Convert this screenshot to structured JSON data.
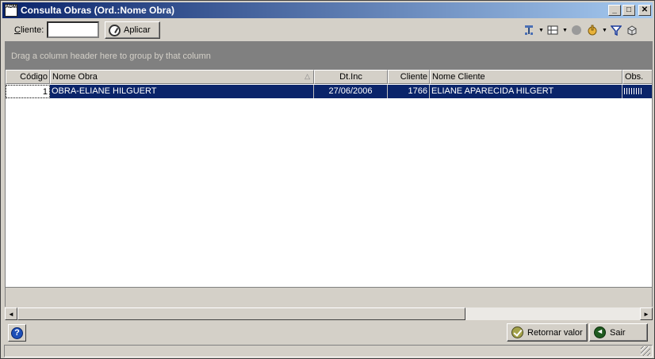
{
  "window": {
    "title": "Consulta Obras (Ord.:Nome Obra)",
    "icon_text": "ADM",
    "minimize": "_",
    "maximize": "□",
    "close": "✕"
  },
  "toolbar": {
    "cliente_label": "Cliente:",
    "cliente_value": "",
    "aplicar_label": "Aplicar",
    "icons": [
      "layout-icon",
      "columns-icon",
      "circle-icon",
      "hand-icon",
      "filter-icon",
      "export-icon"
    ]
  },
  "group_panel": {
    "hint": "Drag a column header here to group by that column"
  },
  "grid": {
    "columns": [
      "Código",
      "Nome Obra",
      "Dt.Inc",
      "Cliente",
      "Nome Cliente",
      "Obs."
    ],
    "sorted_column": "Nome Obra",
    "rows": [
      {
        "codigo": "1",
        "nome_obra": "OBRA-ELIANE HILGUERT",
        "dt_inc": "27/06/2006",
        "cliente": "1766",
        "nome_cliente": "ELIANE APARECIDA  HILGERT",
        "obs": ""
      }
    ]
  },
  "footer": {
    "help": "?",
    "retornar_label": "Retornar valor",
    "sair_label": "Sair"
  },
  "scrollbar": {
    "left_arrow": "◄",
    "right_arrow": "►"
  }
}
